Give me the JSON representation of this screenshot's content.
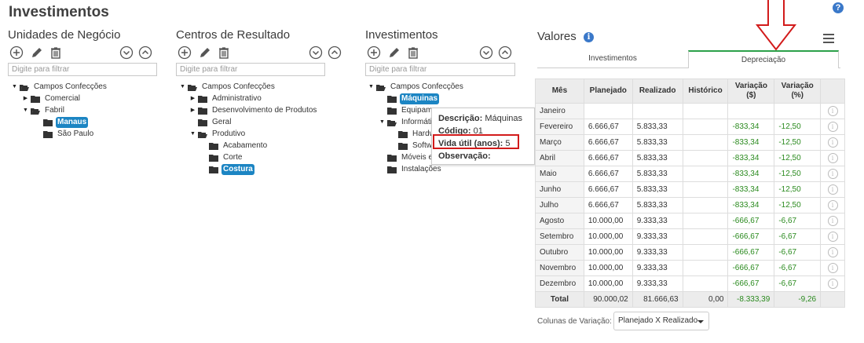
{
  "page": {
    "title": "Investimentos",
    "help": "?"
  },
  "filter_placeholder": "Digite para filtrar",
  "panels": {
    "unidades": {
      "title": "Unidades de Negócio",
      "nodes": [
        "Campos Confecções",
        "Comercial",
        "Fabril",
        "Manaus",
        "São Paulo"
      ]
    },
    "centros": {
      "title": "Centros de Resultado",
      "nodes": [
        "Campos Confecções",
        "Administrativo",
        "Desenvolvimento de Produtos",
        "Geral",
        "Produtivo",
        "Acabamento",
        "Corte",
        "Costura"
      ]
    },
    "investimentos": {
      "title": "Investimentos",
      "nodes": [
        "Campos Confecções",
        "Máquinas",
        "Equipam",
        "Informáti",
        "Hardw",
        "Softwa",
        "Móveis e",
        "Instalações"
      ]
    }
  },
  "tooltip": {
    "descricao_label": "Descrição:",
    "descricao": "Máquinas",
    "codigo_label": "Código:",
    "codigo": "01",
    "vida_label": "Vida útil (anos):",
    "vida": "5",
    "obs_label": "Observação:"
  },
  "valores": {
    "title": "Valores",
    "info": "i",
    "tabs": [
      "Investimentos",
      "Depreciação"
    ],
    "active_tab": "Depreciação",
    "columns": [
      "Mês",
      "Planejado",
      "Realizado",
      "Histórico",
      "Variação ($)",
      "Variação (%)"
    ],
    "rows": [
      [
        "Janeiro",
        "",
        "",
        "",
        "",
        ""
      ],
      [
        "Fevereiro",
        "6.666,67",
        "5.833,33",
        "",
        "-833,34",
        "-12,50"
      ],
      [
        "Março",
        "6.666,67",
        "5.833,33",
        "",
        "-833,34",
        "-12,50"
      ],
      [
        "Abril",
        "6.666,67",
        "5.833,33",
        "",
        "-833,34",
        "-12,50"
      ],
      [
        "Maio",
        "6.666,67",
        "5.833,33",
        "",
        "-833,34",
        "-12,50"
      ],
      [
        "Junho",
        "6.666,67",
        "5.833,33",
        "",
        "-833,34",
        "-12,50"
      ],
      [
        "Julho",
        "6.666,67",
        "5.833,33",
        "",
        "-833,34",
        "-12,50"
      ],
      [
        "Agosto",
        "10.000,00",
        "9.333,33",
        "",
        "-666,67",
        "-6,67"
      ],
      [
        "Setembro",
        "10.000,00",
        "9.333,33",
        "",
        "-666,67",
        "-6,67"
      ],
      [
        "Outubro",
        "10.000,00",
        "9.333,33",
        "",
        "-666,67",
        "-6,67"
      ],
      [
        "Novembro",
        "10.000,00",
        "9.333,33",
        "",
        "-666,67",
        "-6,67"
      ],
      [
        "Dezembro",
        "10.000,00",
        "9.333,33",
        "",
        "-666,67",
        "-6,67"
      ]
    ],
    "total": [
      "Total",
      "90.000,02",
      "81.666,63",
      "0,00",
      "-8.333,39",
      "-9,26"
    ],
    "footer_label": "Colunas de Variação:",
    "footer_select": "Planejado X Realizado"
  },
  "colors": {
    "accent": "#1c85c3",
    "positive_green": "#2a8a1e",
    "highlight_red": "#d21b1b",
    "tab_active": "#2ca14a"
  }
}
